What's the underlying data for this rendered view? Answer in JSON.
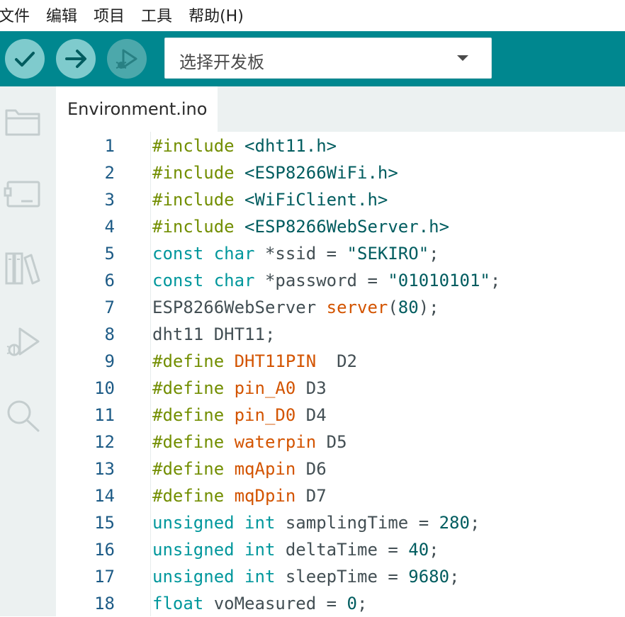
{
  "menu": {
    "file": "文件",
    "edit": "编辑",
    "project": "项目",
    "tools": "工具",
    "help": "帮助(H)"
  },
  "toolbar": {
    "verify_icon": "check-icon",
    "upload_icon": "arrow-right-icon",
    "debug_icon": "debug-icon",
    "board_select": "选择开发板"
  },
  "sidebar": {
    "icons": [
      "folder-icon",
      "board-manager-icon",
      "library-icon",
      "debug-icon",
      "search-icon"
    ]
  },
  "tab": {
    "filename": "Environment.ino"
  },
  "colors": {
    "toolbar_bg": "#00878f",
    "button_bg": "#7fcbcd",
    "sidebar_bg": "#ecf1f1",
    "keyword_green": "#728e00",
    "keyword_teal": "#00979c",
    "keyword_orange": "#d35400",
    "line_number": "#1d5b86"
  },
  "code": {
    "lines": [
      {
        "n": "1",
        "tokens": [
          [
            "kw-green",
            "#include"
          ],
          [
            "plain",
            " "
          ],
          [
            "str",
            "<dht11.h>"
          ]
        ]
      },
      {
        "n": "2",
        "tokens": [
          [
            "kw-green",
            "#include"
          ],
          [
            "plain",
            " "
          ],
          [
            "str",
            "<ESP8266WiFi.h>"
          ]
        ]
      },
      {
        "n": "3",
        "tokens": [
          [
            "kw-green",
            "#include"
          ],
          [
            "plain",
            " "
          ],
          [
            "str",
            "<WiFiClient.h>"
          ]
        ]
      },
      {
        "n": "4",
        "tokens": [
          [
            "kw-green",
            "#include"
          ],
          [
            "plain",
            " "
          ],
          [
            "str",
            "<ESP8266WebServer.h>"
          ]
        ]
      },
      {
        "n": "5",
        "tokens": [
          [
            "kw-teal",
            "const"
          ],
          [
            "plain",
            " "
          ],
          [
            "kw-teal",
            "char"
          ],
          [
            "plain",
            " *ssid = "
          ],
          [
            "str",
            "\"SEKIRO\""
          ],
          [
            "plain",
            ";"
          ]
        ]
      },
      {
        "n": "6",
        "tokens": [
          [
            "kw-teal",
            "const"
          ],
          [
            "plain",
            " "
          ],
          [
            "kw-teal",
            "char"
          ],
          [
            "plain",
            " *password = "
          ],
          [
            "str",
            "\"01010101\""
          ],
          [
            "plain",
            ";"
          ]
        ]
      },
      {
        "n": "7",
        "tokens": [
          [
            "plain",
            "ESP8266WebServer "
          ],
          [
            "kw-orange",
            "server"
          ],
          [
            "plain",
            "("
          ],
          [
            "num",
            "80"
          ],
          [
            "plain",
            ");"
          ]
        ]
      },
      {
        "n": "8",
        "tokens": [
          [
            "plain",
            "dht11 DHT11;"
          ]
        ]
      },
      {
        "n": "9",
        "tokens": [
          [
            "kw-green",
            "#define"
          ],
          [
            "plain",
            " "
          ],
          [
            "kw-orange",
            "DHT11PIN"
          ],
          [
            "plain",
            "  D2"
          ]
        ]
      },
      {
        "n": "10",
        "tokens": [
          [
            "kw-green",
            "#define"
          ],
          [
            "plain",
            " "
          ],
          [
            "kw-orange",
            "pin_A0"
          ],
          [
            "plain",
            " D3"
          ]
        ]
      },
      {
        "n": "11",
        "tokens": [
          [
            "kw-green",
            "#define"
          ],
          [
            "plain",
            " "
          ],
          [
            "kw-orange",
            "pin_D0"
          ],
          [
            "plain",
            " D4"
          ]
        ]
      },
      {
        "n": "12",
        "tokens": [
          [
            "kw-green",
            "#define"
          ],
          [
            "plain",
            " "
          ],
          [
            "kw-orange",
            "waterpin"
          ],
          [
            "plain",
            " D5"
          ]
        ]
      },
      {
        "n": "13",
        "tokens": [
          [
            "kw-green",
            "#define"
          ],
          [
            "plain",
            " "
          ],
          [
            "kw-orange",
            "mqApin"
          ],
          [
            "plain",
            " D6"
          ]
        ]
      },
      {
        "n": "14",
        "tokens": [
          [
            "kw-green",
            "#define"
          ],
          [
            "plain",
            " "
          ],
          [
            "kw-orange",
            "mqDpin"
          ],
          [
            "plain",
            " D7"
          ]
        ]
      },
      {
        "n": "15",
        "tokens": [
          [
            "kw-teal",
            "unsigned"
          ],
          [
            "plain",
            " "
          ],
          [
            "kw-teal",
            "int"
          ],
          [
            "plain",
            " samplingTime = "
          ],
          [
            "num",
            "280"
          ],
          [
            "plain",
            ";"
          ]
        ]
      },
      {
        "n": "16",
        "tokens": [
          [
            "kw-teal",
            "unsigned"
          ],
          [
            "plain",
            " "
          ],
          [
            "kw-teal",
            "int"
          ],
          [
            "plain",
            " deltaTime = "
          ],
          [
            "num",
            "40"
          ],
          [
            "plain",
            ";"
          ]
        ]
      },
      {
        "n": "17",
        "tokens": [
          [
            "kw-teal",
            "unsigned"
          ],
          [
            "plain",
            " "
          ],
          [
            "kw-teal",
            "int"
          ],
          [
            "plain",
            " sleepTime = "
          ],
          [
            "num",
            "9680"
          ],
          [
            "plain",
            ";"
          ]
        ]
      },
      {
        "n": "18",
        "tokens": [
          [
            "kw-teal",
            "float"
          ],
          [
            "plain",
            " voMeasured = "
          ],
          [
            "num",
            "0"
          ],
          [
            "plain",
            ";"
          ]
        ]
      }
    ]
  }
}
